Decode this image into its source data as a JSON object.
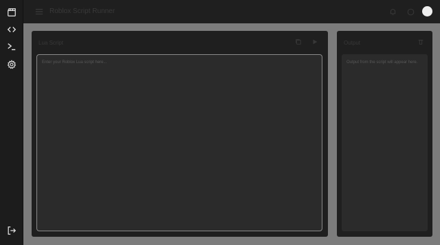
{
  "app": {
    "title": "Roblox Script Runner"
  },
  "sidebar": {
    "items": [
      {
        "icon": "clapperboard-icon"
      },
      {
        "icon": "code-icon"
      },
      {
        "icon": "terminal-icon"
      },
      {
        "icon": "gear-icon"
      }
    ],
    "bottom": {
      "icon": "logout-icon"
    }
  },
  "editor": {
    "label": "Lua Script",
    "placeholder": "Enter your Roblox Lua script here..."
  },
  "output": {
    "label": "Output",
    "placeholder": "Output from the script will appear here."
  },
  "colors": {
    "sidebar_bg": "#1c1c1c",
    "panel_bg": "#1f1f1f",
    "area_bg": "#2b2b2b",
    "page_bg": "#7c7c7c",
    "icon": "#e6e6e6"
  }
}
